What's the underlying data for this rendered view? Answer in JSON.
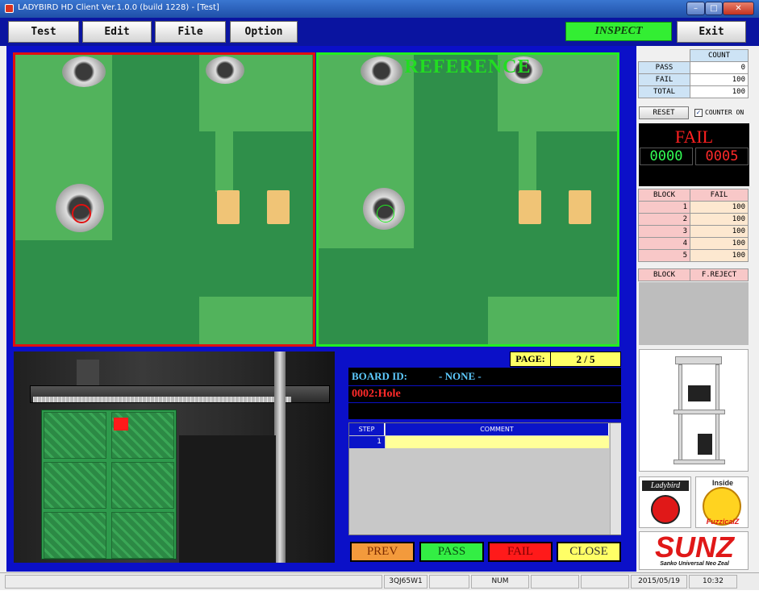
{
  "window": {
    "title": "LADYBIRD HD Client Ver.1.0.0  (build 1228) - [Test]",
    "controls": {
      "minimize": "–",
      "maximize": "□",
      "close": "✕"
    }
  },
  "toolbar": {
    "test_label": "Test",
    "edit_label": "Edit",
    "file_label": "File",
    "option_label": "Option",
    "inspect_label": "INSPECT",
    "exit_label": "Exit"
  },
  "reference": {
    "label": "REFERENCE"
  },
  "info": {
    "page_label": "PAGE:",
    "page_value": "2 / 5",
    "board_id_label": "BOARD ID:",
    "board_id_value": "- NONE -",
    "defect": "0002:Hole",
    "step_table": {
      "headers": [
        "STEP",
        "COMMENT"
      ],
      "rows": [
        {
          "step": "1",
          "comment": ""
        }
      ]
    }
  },
  "actions": {
    "prev": "PREV",
    "pass": "PASS",
    "fail": "FAIL",
    "close": "CLOSE"
  },
  "counter": {
    "header": "COUNT",
    "rows": [
      {
        "label": "PASS",
        "value": "0"
      },
      {
        "label": "FAIL",
        "value": "100"
      },
      {
        "label": "TOTAL",
        "value": "100"
      }
    ],
    "reset_label": "RESET",
    "counter_on_label": "COUNTER ON",
    "counter_on_checked": true
  },
  "result": {
    "status": "FAIL",
    "left_count": "0000",
    "right_count": "0005"
  },
  "blocks": {
    "headers": [
      "BLOCK",
      "FAIL"
    ],
    "rows": [
      {
        "block": "1",
        "fail": "100"
      },
      {
        "block": "2",
        "fail": "100"
      },
      {
        "block": "3",
        "fail": "100"
      },
      {
        "block": "4",
        "fail": "100"
      },
      {
        "block": "5",
        "fail": "100"
      }
    ]
  },
  "reject": {
    "headers": [
      "BLOCK",
      "F.REJECT"
    ]
  },
  "logos": {
    "ladybird": "Ladybird",
    "fuzzical_inside": "Inside",
    "fuzzical": "FuzzicalZ",
    "sunz": "SUNZ",
    "sunz_sub": "Sanko Universal Neo Zeal"
  },
  "statusbar": {
    "code": "3QJ65W1",
    "num": "NUM",
    "date": "2015/05/19",
    "time": "10:32"
  },
  "colors": {
    "accent_blue": "#0b10c8",
    "fail_red": "#e01010",
    "reference_green": "#22ee22",
    "inspect_green": "#33ee33"
  }
}
